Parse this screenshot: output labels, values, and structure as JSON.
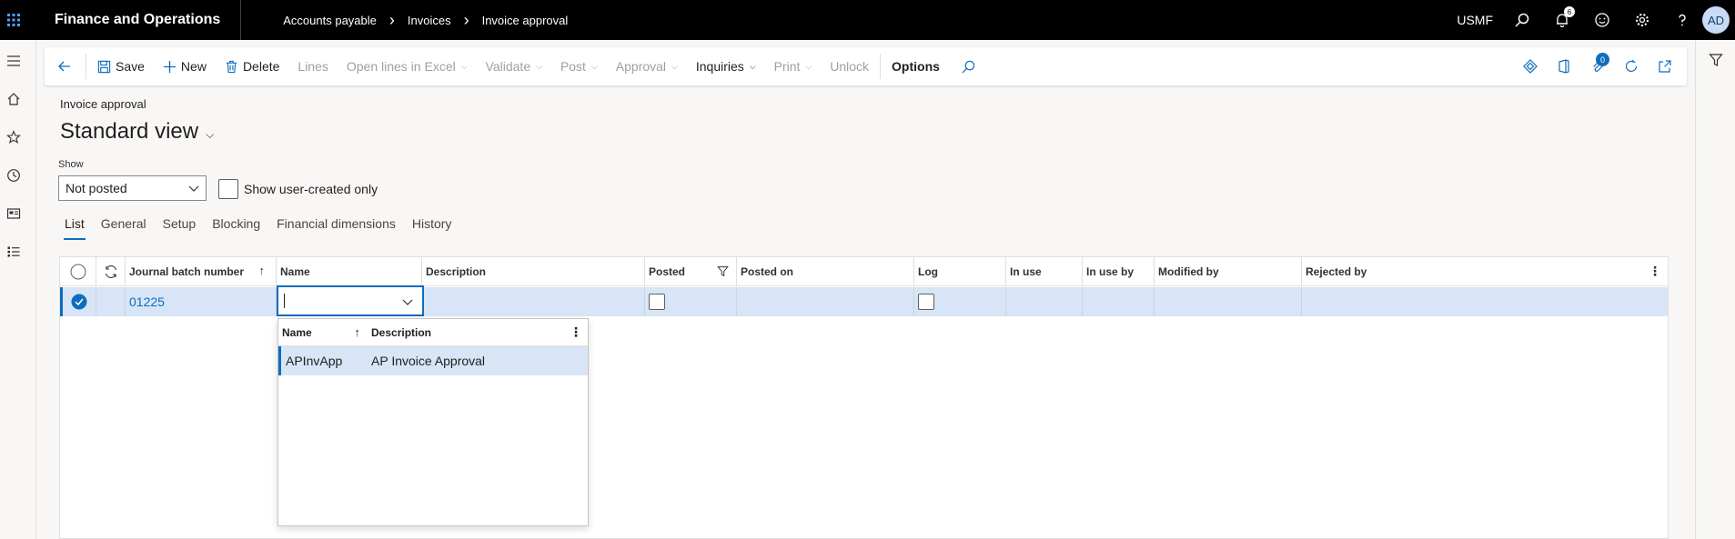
{
  "app": {
    "title": "Finance and Operations",
    "company": "USMF",
    "avatar_initials": "AD",
    "notification_count": "6"
  },
  "breadcrumbs": [
    "Accounts payable",
    "Invoices",
    "Invoice approval"
  ],
  "actions": {
    "save": "Save",
    "new": "New",
    "delete": "Delete",
    "lines": "Lines",
    "open_excel": "Open lines in Excel",
    "validate": "Validate",
    "post": "Post",
    "approval": "Approval",
    "inquiries": "Inquiries",
    "print": "Print",
    "unlock": "Unlock",
    "options": "Options",
    "attachments_count": "0"
  },
  "form": {
    "caption": "Invoice approval",
    "view_name": "Standard view"
  },
  "filters": {
    "show_label": "Show",
    "show_value": "Not posted",
    "user_created_label": "Show user-created only"
  },
  "tabs": [
    "List",
    "General",
    "Setup",
    "Blocking",
    "Financial dimensions",
    "History"
  ],
  "grid": {
    "columns": [
      "Journal batch number",
      "Name",
      "Description",
      "Posted",
      "Posted on",
      "Log",
      "In use",
      "In use by",
      "Modified by",
      "Rejected by"
    ],
    "rows": [
      {
        "journal_batch_number": "01225",
        "name": "",
        "description": "",
        "posted_on": "",
        "in_use": "",
        "in_use_by": "",
        "modified_by": "",
        "rejected_by": ""
      }
    ]
  },
  "lookup": {
    "columns": [
      "Name",
      "Description"
    ],
    "rows": [
      {
        "name": "APInvApp",
        "description": "AP Invoice Approval"
      }
    ]
  },
  "colors": {
    "accent": "#0f6cbd",
    "selected_row": "#d7e5f7",
    "topbar": "#000000"
  }
}
